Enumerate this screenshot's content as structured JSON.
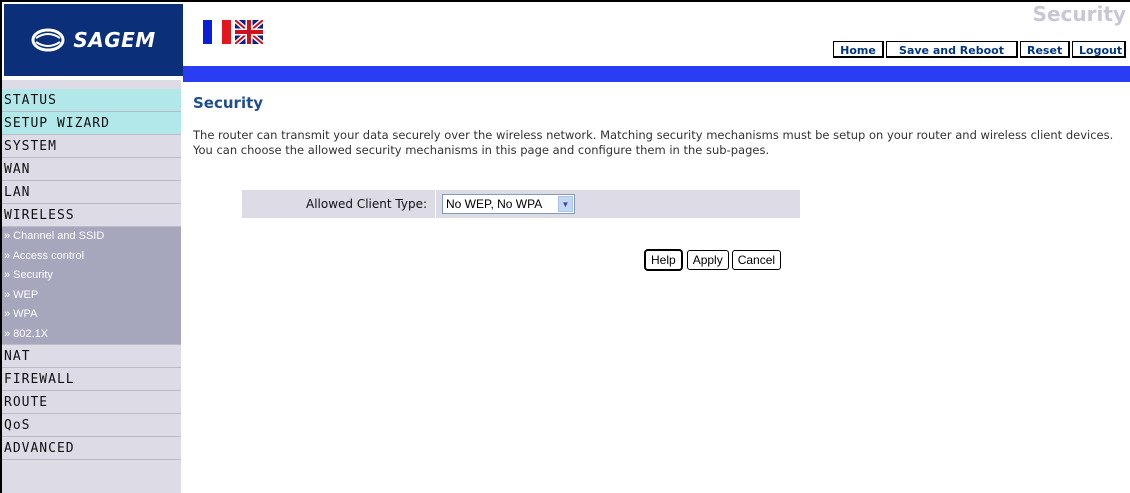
{
  "brand": {
    "name": "SAGEM"
  },
  "page_heading": "Security",
  "topnav": [
    {
      "label": "Home"
    },
    {
      "label": "Save and Reboot"
    },
    {
      "label": "Reset"
    },
    {
      "label": "Logout"
    }
  ],
  "sidebar": {
    "items": [
      {
        "label": "STATUS",
        "selected": true
      },
      {
        "label": "SETUP WIZARD",
        "selected": true
      },
      {
        "label": "SYSTEM"
      },
      {
        "label": "WAN"
      },
      {
        "label": "LAN"
      },
      {
        "label": "WIRELESS"
      }
    ],
    "subitems": [
      {
        "label": "» Channel and SSID"
      },
      {
        "label": "» Access control"
      },
      {
        "label": "» Security"
      },
      {
        "label": "» WEP"
      },
      {
        "label": "» WPA"
      },
      {
        "label": "» 802.1X"
      }
    ],
    "items_after": [
      {
        "label": "NAT"
      },
      {
        "label": "FIREWALL"
      },
      {
        "label": "ROUTE"
      },
      {
        "label": "QoS"
      },
      {
        "label": "ADVANCED"
      }
    ]
  },
  "main": {
    "title": "Security",
    "description": "The router can transmit your data securely over the wireless network. Matching security mechanisms must be setup on your router and wireless client devices. You can choose the allowed security mechanisms in this page and configure them in the sub-pages.",
    "form": {
      "label": "Allowed Client Type:",
      "select_value": "No WEP, No WPA"
    },
    "actions": {
      "help": "Help",
      "apply": "Apply",
      "cancel": "Cancel"
    }
  },
  "colors": {
    "logo_bg": "#0b2f78",
    "band": "#2b3cf5",
    "title": "#1f4e8c",
    "menu_bg": "#dcdbe6",
    "menu_selected": "#b3e8ea",
    "submenu_bg": "#a6a6bd"
  }
}
